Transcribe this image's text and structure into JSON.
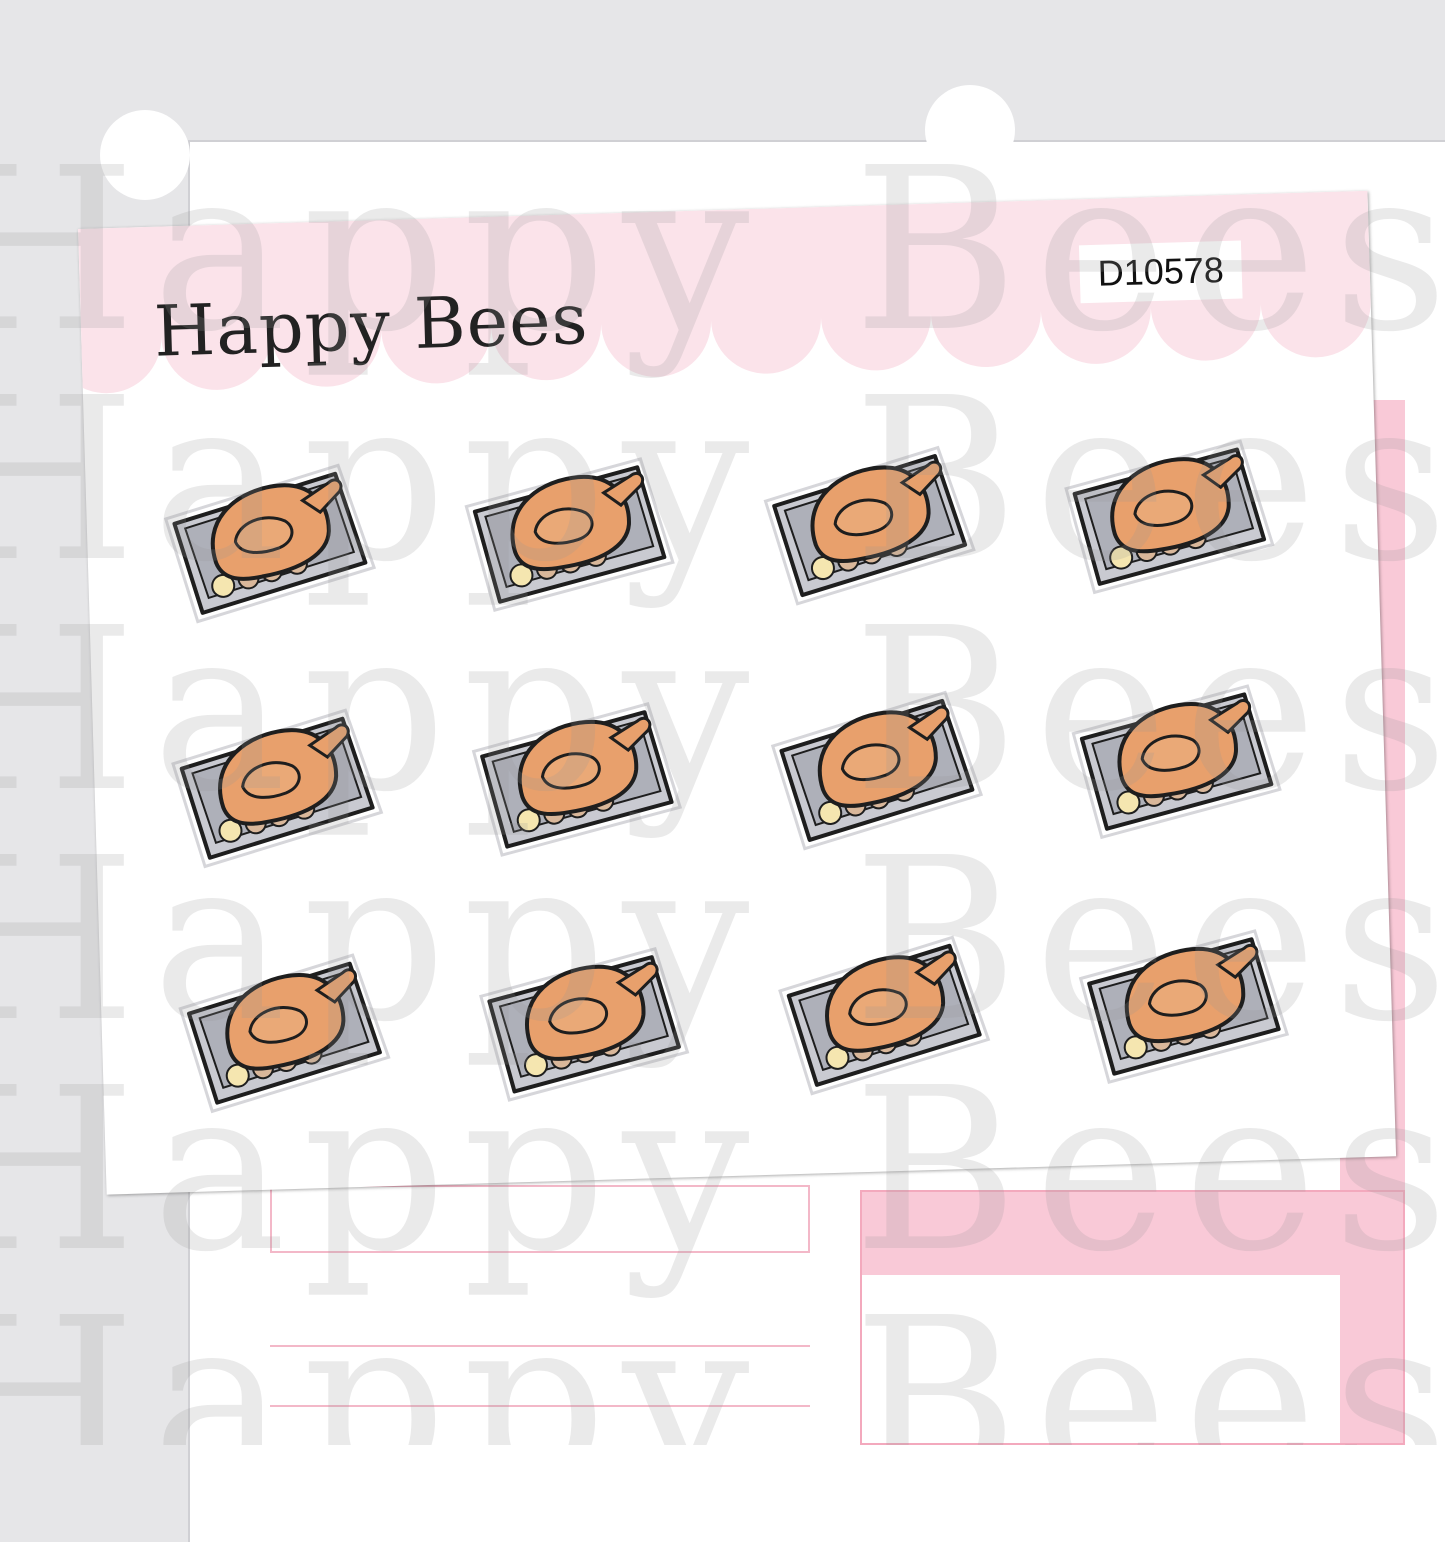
{
  "sheet": {
    "brand": "Happy Bees",
    "product_code": "D10578"
  },
  "stickers": {
    "rows": 3,
    "columns": 4,
    "icon": "roast-turkey-in-pan-icon",
    "colors": {
      "turkey": "#e8a06c",
      "turkey_outline": "#1e1e1e",
      "pan": "#c9cad1",
      "header_pink": "#fbe3ea"
    }
  },
  "watermark": {
    "text": "Happy Bees"
  }
}
